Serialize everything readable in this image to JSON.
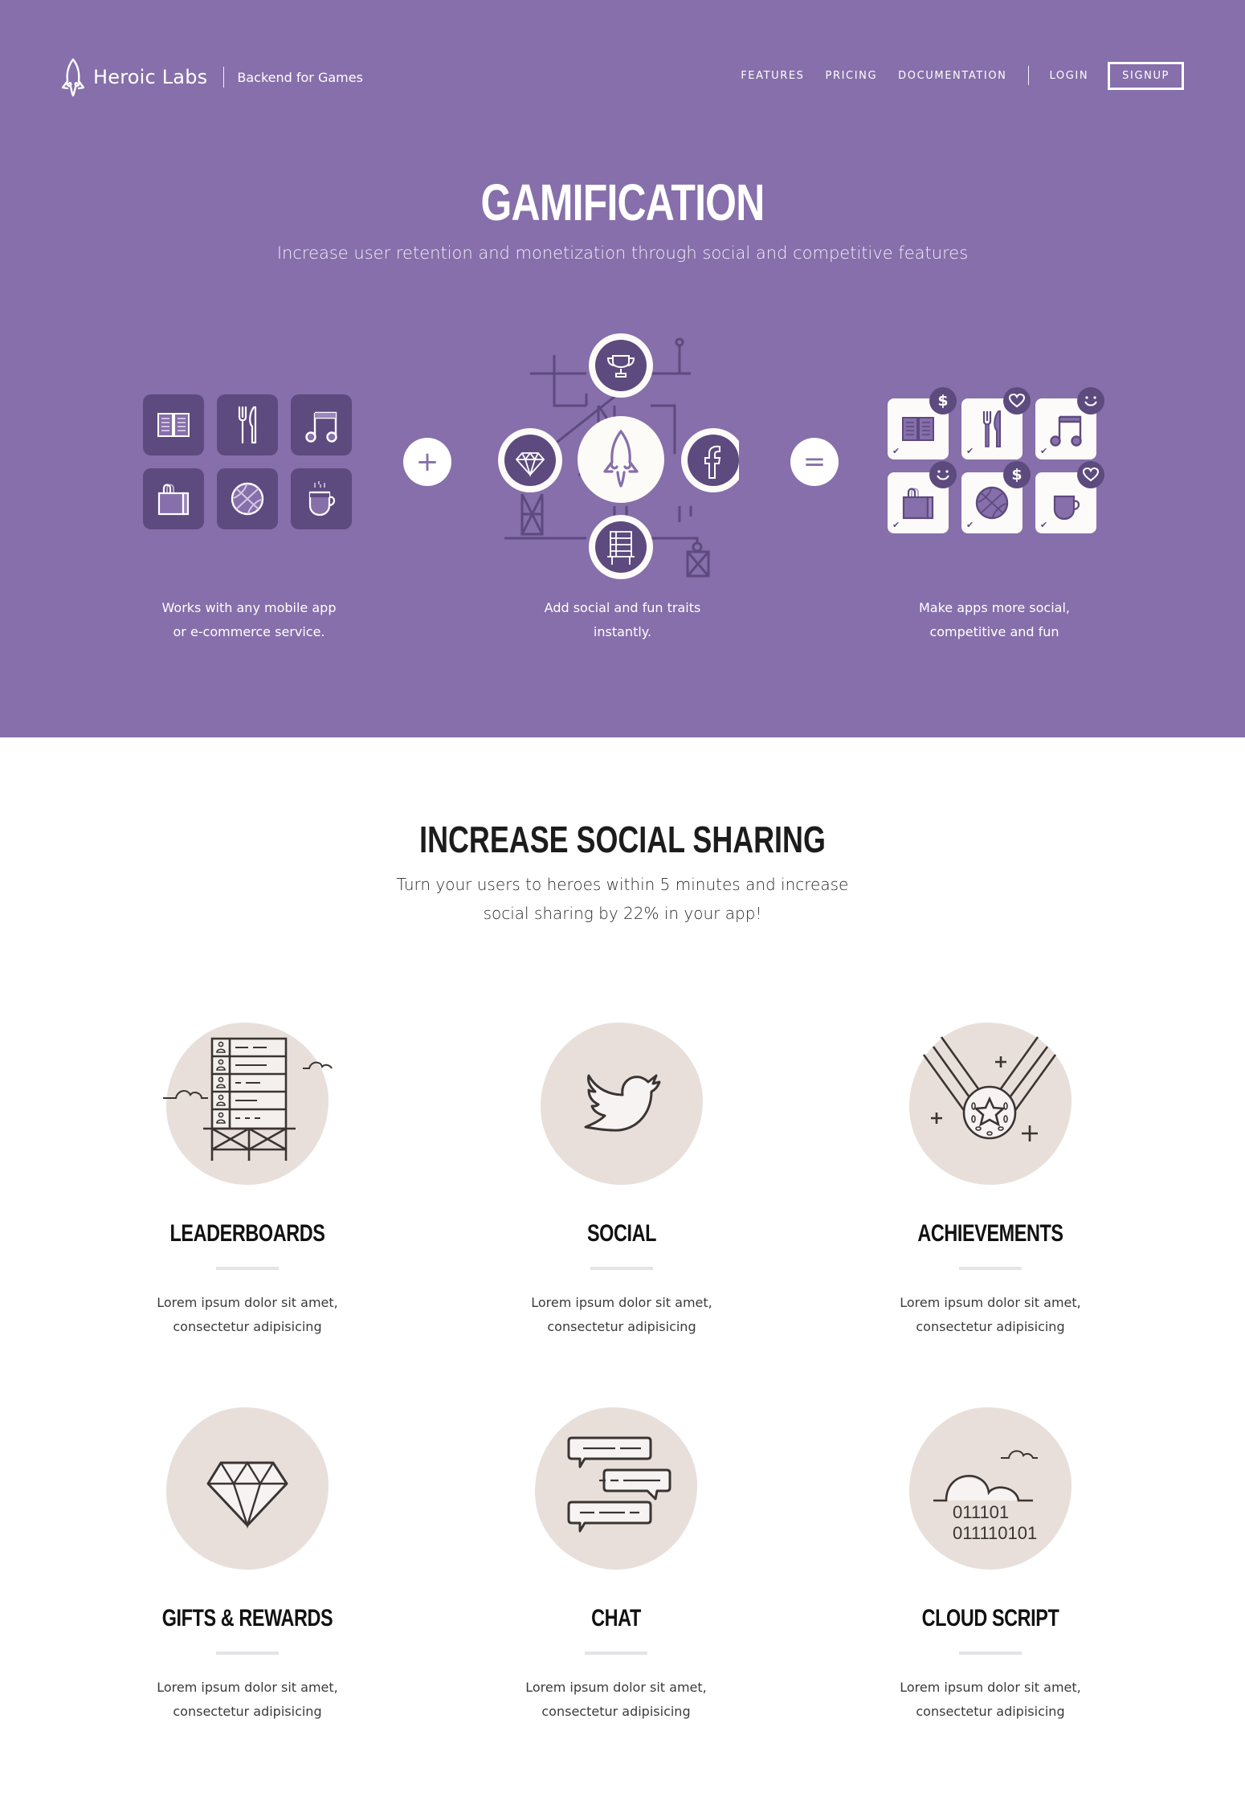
{
  "header": {
    "brand": "Heroic Labs",
    "tagline": "Backend for Games",
    "nav": [
      {
        "label": "FEATURES"
      },
      {
        "label": "PRICING"
      },
      {
        "label": "DOCUMENTATION"
      },
      {
        "label": "LOGIN"
      },
      {
        "label": "SIGNUP"
      }
    ]
  },
  "hero": {
    "title": "GAMIFICATION",
    "subtitle": "Increase user retention and monetization through social and competitive features",
    "left_icons": [
      "book-icon",
      "cutlery-icon",
      "music-note-icon",
      "shopping-bag-icon",
      "basketball-icon",
      "coffee-cup-icon"
    ],
    "plus_symbol": "+",
    "equals_symbol": "=",
    "center_icons": [
      "trophy-icon",
      "diamond-icon",
      "rocket-icon",
      "facebook-icon",
      "leaderboard-icon"
    ],
    "right_badges": [
      "$",
      "heart",
      "smile",
      "smile",
      "$",
      "heart"
    ],
    "captions": [
      {
        "line1": "Works with any mobile app",
        "line2": "or e-commerce service."
      },
      {
        "line1": "Add social and fun traits",
        "line2": "instantly."
      },
      {
        "line1": "Make apps more social,",
        "line2": "competitive and fun"
      }
    ],
    "colors": {
      "background": "#866faa",
      "tile": "#5d4a7e",
      "white": "#ffffff"
    }
  },
  "social_section": {
    "title": "INCREASE SOCIAL SHARING",
    "subtitle_line1": "Turn your users to heroes within 5 minutes and increase",
    "subtitle_line2": "social sharing by 22% in your app!",
    "features": [
      {
        "title": "LEADERBOARDS",
        "icon": "leaderboard-icon",
        "desc_line1": "Lorem ipsum dolor sit amet,",
        "desc_line2": "consectetur adipisicing"
      },
      {
        "title": "SOCIAL",
        "icon": "twitter-bird-icon",
        "desc_line1": "Lorem ipsum dolor sit amet,",
        "desc_line2": "consectetur adipisicing"
      },
      {
        "title": "ACHIEVEMENTS",
        "icon": "medal-icon",
        "desc_line1": "Lorem ipsum dolor sit amet,",
        "desc_line2": "consectetur adipisicing"
      },
      {
        "title": "GIFTS & REWARDS",
        "icon": "diamond-icon",
        "desc_line1": "Lorem ipsum dolor sit amet,",
        "desc_line2": "consectetur adipisicing"
      },
      {
        "title": "CHAT",
        "icon": "chat-bubbles-icon",
        "desc_line1": "Lorem ipsum dolor sit amet,",
        "desc_line2": "consectetur adipisicing"
      },
      {
        "title": "CLOUD SCRIPT",
        "icon": "cloud-code-icon",
        "desc_line1": "Lorem ipsum dolor sit amet,",
        "desc_line2": "consectetur adipisicing"
      }
    ],
    "cloud_code_line1": "011101",
    "cloud_code_line2": "011110101"
  }
}
